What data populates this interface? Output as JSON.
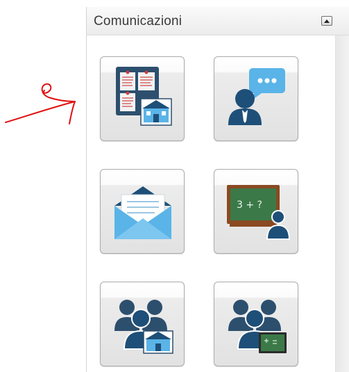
{
  "panel": {
    "title": "Comunicazioni"
  },
  "tiles": [
    {
      "icon": "bulletin-board-school-icon"
    },
    {
      "icon": "teacher-chat-icon"
    },
    {
      "icon": "envelope-icon"
    },
    {
      "icon": "classroom-blackboard-icon"
    },
    {
      "icon": "group-school-icon"
    },
    {
      "icon": "group-blackboard-icon"
    }
  ],
  "colors": {
    "annotation_red": "#e01010",
    "icon_dark_blue": "#1e4f78",
    "icon_light_blue": "#5ab4e8",
    "board_green": "#3b7a48",
    "board_frame": "#8a4a22"
  }
}
